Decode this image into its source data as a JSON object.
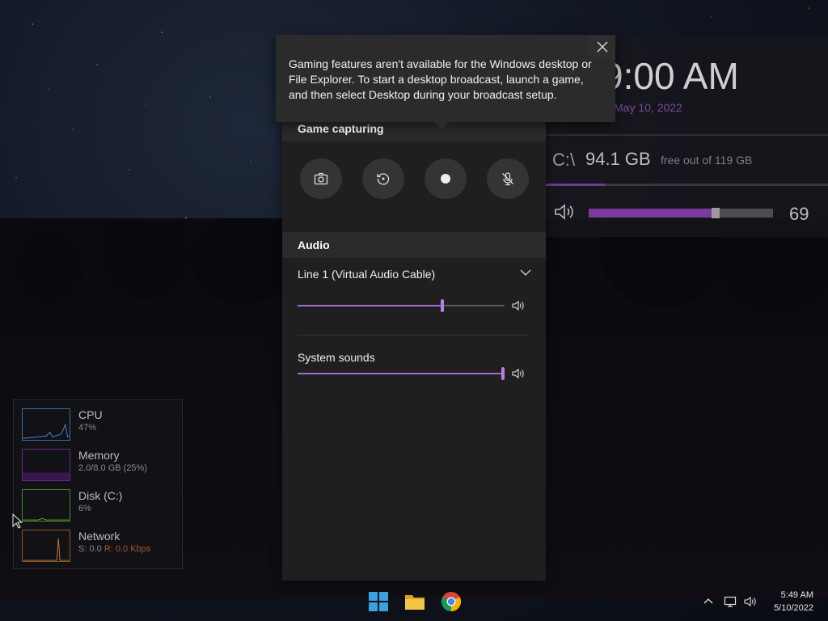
{
  "desktop": {
    "clock_widget": {
      "time": "9:00 AM",
      "date": "May 10, 2022",
      "drive_letter": "C:\\",
      "drive_free": "94.1 GB",
      "drive_total": "free out of 119 GB",
      "drive_used_fraction": 0.21,
      "volume_value": "69",
      "volume_fraction": 0.69
    },
    "perf_widget": {
      "rows": [
        {
          "name": "CPU",
          "value": "47%",
          "color": "#3a6fa0"
        },
        {
          "name": "Memory",
          "value": "2.0/8.0 GB (25%)",
          "color": "#6a2a8a"
        },
        {
          "name": "Disk (C:)",
          "value": "6%",
          "color": "#3f8a2a"
        },
        {
          "name": "Network",
          "value_s": "S: 0.0",
          "value_r": "R: 0.0 Kbps",
          "color": "#8a5a20"
        }
      ]
    }
  },
  "tooltip": {
    "text": "Gaming features aren't available for the Windows desktop or File Explorer. To start a desktop broadcast, launch a game, and then select Desktop during your broadcast setup."
  },
  "gamebar": {
    "capture": {
      "title": "Game capturing",
      "buttons": [
        "camera-icon",
        "replay-icon",
        "record-icon",
        "mic-off-icon"
      ]
    },
    "audio": {
      "title": "Audio",
      "device": "Line 1 (Virtual Audio Cable)",
      "device_level": 0.7,
      "system_label": "System sounds",
      "system_level": 1.0
    }
  },
  "taskbar": {
    "apps": [
      "windows-start-icon",
      "file-explorer-icon",
      "chrome-icon"
    ],
    "tray_time": "5:49 AM",
    "tray_date": "5/10/2022"
  },
  "colors": {
    "accent": "#a46bd0",
    "panel": "#1f1f1f",
    "header": "#2b2b2b"
  }
}
